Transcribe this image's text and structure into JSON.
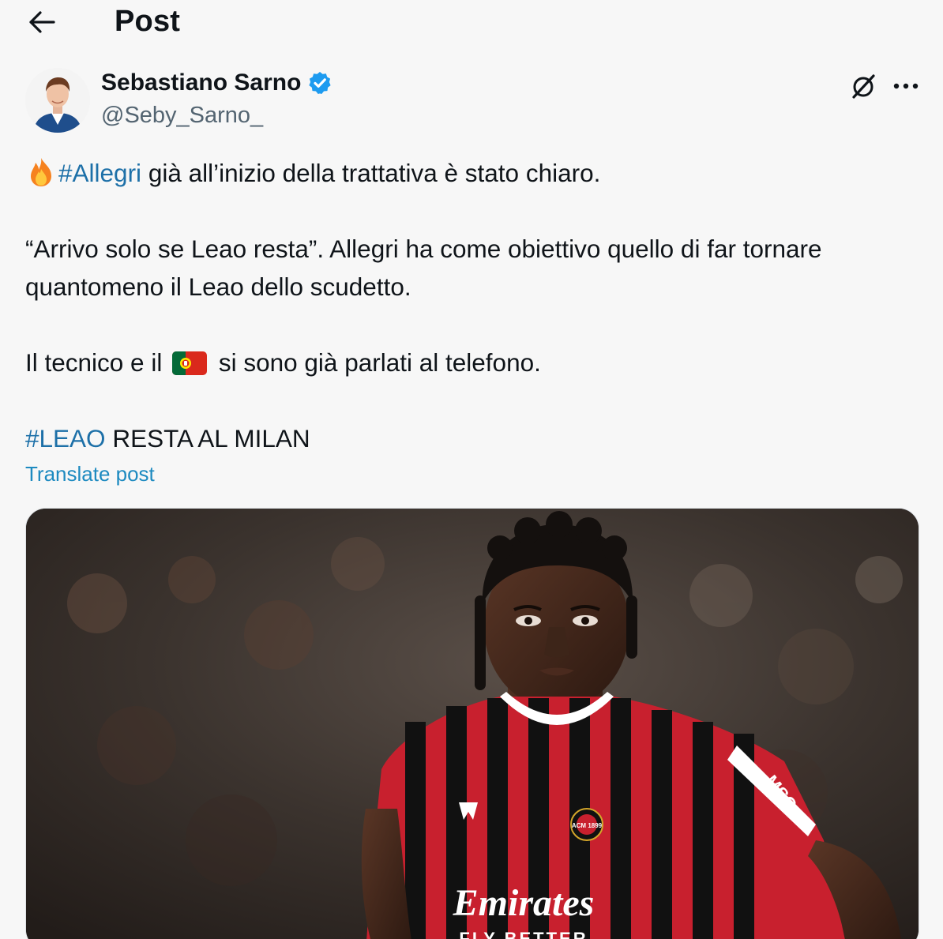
{
  "header": {
    "title": "Post",
    "back_icon": "arrow-left-icon"
  },
  "author": {
    "display_name": "Sebastiano Sarno",
    "handle": "@Seby_Sarno_",
    "verified_icon": "verified-badge-icon",
    "verified_color": "#1d9bf0"
  },
  "actions": {
    "grok_icon": "grok-icon",
    "more_icon": "more-horizontal-icon"
  },
  "post": {
    "line1_emoji": "fire-emoji",
    "line1_hashtag": "#Allegri",
    "line1_text": " già all’inizio della trattativa è stato chiaro.",
    "line2_text": "“Arrivo solo se Leao resta”. Allegri ha come obiettivo quello di far tornare quantomeno il Leao dello scudetto.",
    "line3_text_before": "Il tecnico e il ",
    "line3_flag": "portugal-flag-emoji",
    "line3_text_after": " si sono già parlati al telefono.",
    "line4_hashtag": "#LEAO",
    "line4_text": " RESTA AL MILAN",
    "hashtag_color": "#1d70a8"
  },
  "translate_label": "Translate post",
  "media": {
    "shirt_sponsor": "Emirates",
    "shirt_sponsor_line2": "FLY BETTER",
    "sleeve_text": "MSC",
    "crest_text": "ACM 1899"
  }
}
